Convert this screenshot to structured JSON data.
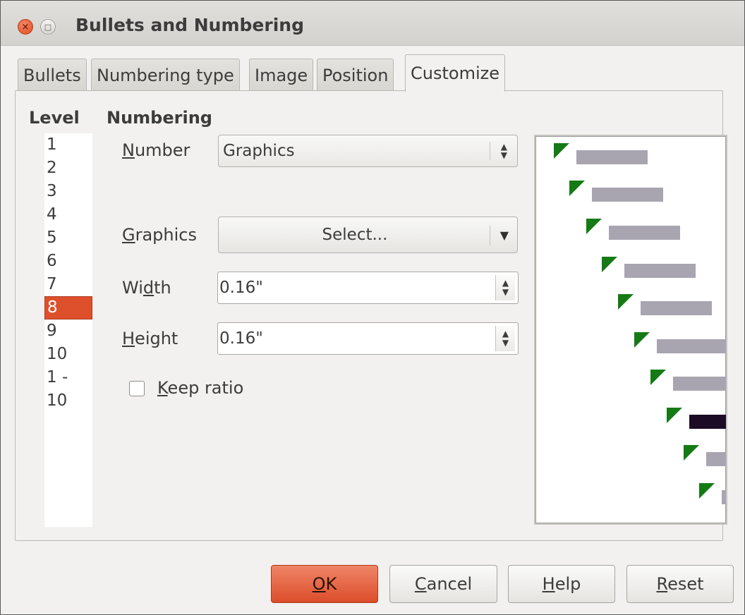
{
  "window": {
    "title": "Bullets and Numbering"
  },
  "tabs": [
    {
      "label": "Bullets"
    },
    {
      "label": "Numbering type"
    },
    {
      "label": "Image"
    },
    {
      "label": "Position"
    },
    {
      "label": "Customize",
      "active": true
    }
  ],
  "level": {
    "title": "Level",
    "items": [
      "1",
      "2",
      "3",
      "4",
      "5",
      "6",
      "7",
      "8",
      "9",
      "10",
      "1 - 10"
    ],
    "selected": "8"
  },
  "numbering": {
    "title": "Numbering",
    "number_label_rest": "umber",
    "number_label_accel": "N",
    "number_value": "Graphics",
    "graphics_label_accel": "G",
    "graphics_label_rest": "raphics",
    "graphics_button": "Select...",
    "width_label_pre": "Wi",
    "width_label_accel": "d",
    "width_label_post": "th",
    "width_value": "0.16\"",
    "height_label_accel": "H",
    "height_label_rest": "eight",
    "height_value": "0.16\"",
    "keep_ratio_accel": "K",
    "keep_ratio_rest": "eep ratio",
    "keep_ratio_checked": false
  },
  "preview": {
    "selected_level": 8
  },
  "buttons": {
    "ok_accel": "O",
    "ok_rest": "K",
    "cancel_accel": "C",
    "cancel_rest": "ancel",
    "help_accel": "H",
    "help_rest": "elp",
    "reset_accel": "R",
    "reset_rest": "eset"
  },
  "colors": {
    "accent": "#de4f2b",
    "bullet": "#157a16",
    "preview_bar": "#a8a5b1",
    "preview_bar_selected": "#1c0b24"
  }
}
